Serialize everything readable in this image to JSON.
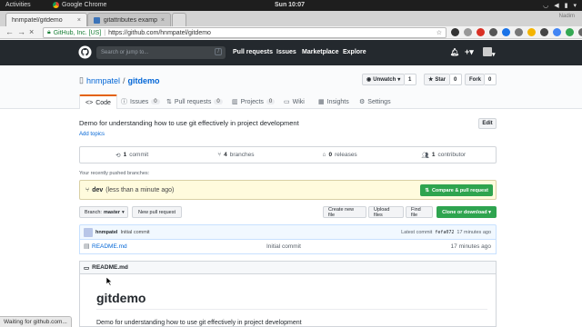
{
  "os": {
    "activities": "Activities",
    "app_name": "Google Chrome",
    "clock": "Sun 10:07"
  },
  "browser": {
    "tabs": [
      {
        "title": "hnmpatel/gitdemo",
        "active": true
      },
      {
        "title": "gitattributes examp",
        "active": false
      }
    ],
    "profile": "Nadim",
    "omnibox": {
      "secure_label": "GitHub, Inc. [US]",
      "separator": "|",
      "url": "https://github.com/hnmpatel/gitdemo"
    },
    "status_text": "Waiting for github.com..."
  },
  "github": {
    "search_placeholder": "Search or jump to...",
    "search_shortcut": "/",
    "nav": [
      "Pull requests",
      "Issues",
      "Marketplace",
      "Explore"
    ]
  },
  "repo": {
    "owner": "hnmpatel",
    "separator": "/",
    "name": "gitdemo",
    "unwatch_label": "Unwatch",
    "watch_count": "1",
    "star_label": "Star",
    "star_count": "0",
    "fork_label": "Fork",
    "fork_count": "0",
    "tabs": [
      {
        "label": "Code",
        "count": null,
        "active": true
      },
      {
        "label": "Issues",
        "count": "0"
      },
      {
        "label": "Pull requests",
        "count": "0"
      },
      {
        "label": "Projects",
        "count": "0"
      },
      {
        "label": "Wiki",
        "count": null
      },
      {
        "label": "Insights",
        "count": null
      },
      {
        "label": "Settings",
        "count": null
      }
    ],
    "description": "Demo for understanding how to use git effectively in project development",
    "add_topics": "Add topics",
    "edit_label": "Edit",
    "stats": [
      {
        "num": "1",
        "label": "commit"
      },
      {
        "num": "4",
        "label": "branches"
      },
      {
        "num": "0",
        "label": "releases"
      },
      {
        "num": "1",
        "label": "contributor"
      }
    ],
    "pushed_label": "Your recently pushed branches:",
    "pushed_branch": "dev",
    "pushed_ago": "(less than a minute ago)",
    "compare_label": "Compare & pull request",
    "branch_prefix": "Branch:",
    "branch_name": "master",
    "new_pr_label": "New pull request",
    "create_file_label": "Create new file",
    "upload_label": "Upload files",
    "find_label": "Find file",
    "clone_label": "Clone or download",
    "latest_commit": {
      "author": "hnmpatel",
      "message": "Initial commit",
      "prefix": "Latest commit",
      "sha": "fefa072",
      "ago": "17 minutes ago"
    },
    "files": [
      {
        "name": "README.md",
        "message": "Initial commit",
        "age": "17 minutes ago"
      }
    ],
    "readme_header": "README.md",
    "readme_title": "gitdemo",
    "readme_text": "Demo for understanding how to use git effectively in project development"
  }
}
